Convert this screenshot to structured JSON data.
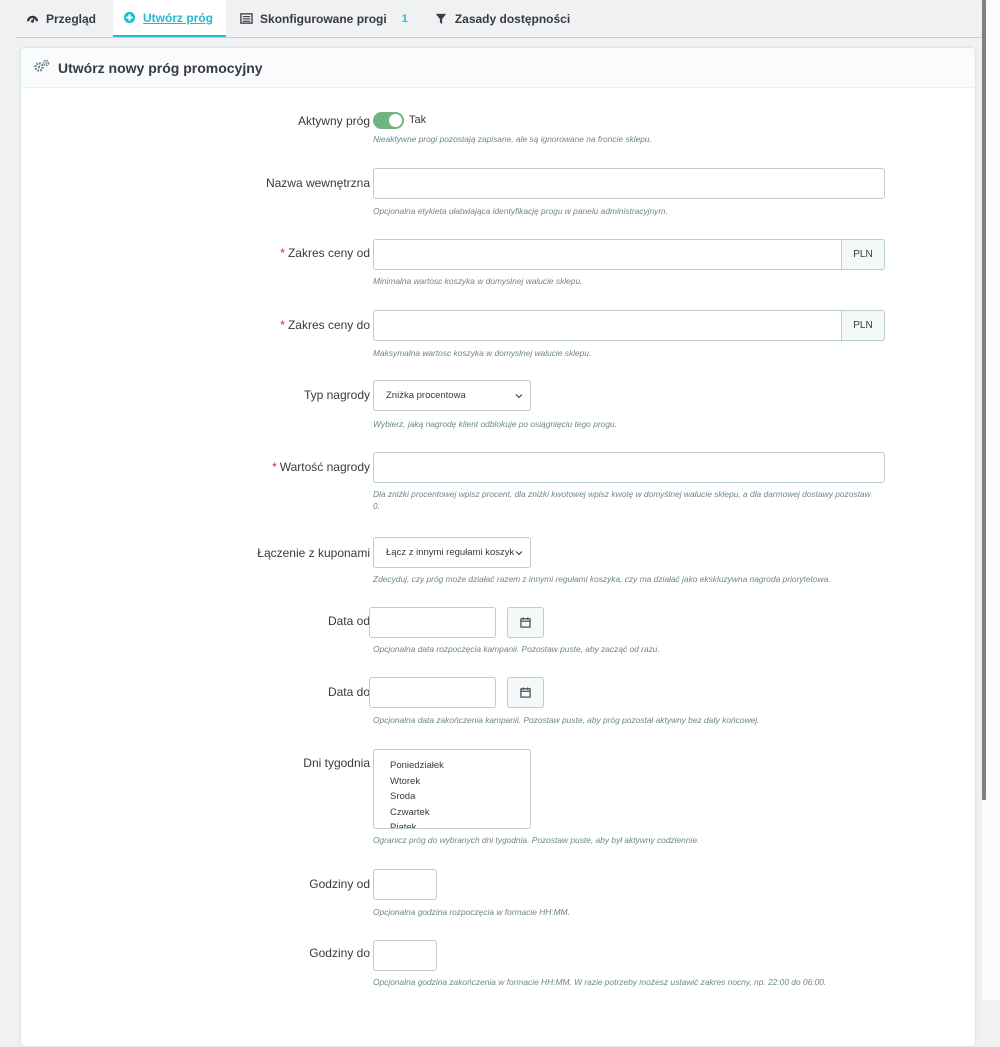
{
  "tabs": [
    {
      "label": "Przegląd",
      "icon": "dashboard-icon"
    },
    {
      "label": "Utwórz próg",
      "icon": "plus-circle-icon",
      "active": true
    },
    {
      "label": "Skonfigurowane progi",
      "icon": "list-icon",
      "badge": "1"
    },
    {
      "label": "Zasady dostępności",
      "icon": "filter-icon"
    }
  ],
  "panel": {
    "title": "Utwórz nowy próg promocyjny",
    "icon": "cogs-icon"
  },
  "form": {
    "active": {
      "label": "Aktywny próg",
      "state": "Tak",
      "on": true,
      "help": "Nieaktywne progi pozostają zapisane, ale są ignorowane na froncie sklepu."
    },
    "name": {
      "label": "Nazwa wewnętrzna",
      "value": "",
      "help": "Opcjonalna etykieta ułatwiająca identyfikację progu w panelu administracyjnym."
    },
    "price_from": {
      "label": "Zakres ceny od",
      "value": "",
      "addon": "PLN",
      "help": "Minimalna wartosc koszyka w domyslnej walucie sklepu."
    },
    "price_to": {
      "label": "Zakres ceny do",
      "value": "",
      "addon": "PLN",
      "help": "Maksymalna wartosc koszyka w domyslnej walucie sklepu."
    },
    "reward_type": {
      "label": "Typ nagrody",
      "value": "Zniżka procentowa",
      "help": "Wybierz, jaką nagrodę klient odblokuje po osiągnięciu tego progu."
    },
    "reward_value": {
      "label": "Wartość nagrody",
      "value": "",
      "help": "Dla zniżki procentowej wpisz procent, dla zniżki kwotowej wpisz kwotę w domyślnej walucie sklepu, a dla darmowej dostawy pozostaw 0."
    },
    "combine": {
      "label": "Łączenie z kuponami",
      "value": "Łącz z innymi regułami koszyka",
      "help": "Zdecyduj, czy próg może działać razem z innymi regułami koszyka, czy ma działać jako ekskluzywna nagroda priorytetowa."
    },
    "date_from": {
      "label": "Data od",
      "value": "",
      "help": "Opcjonalna data rozpoczęcia kampanii. Pozostaw puste, aby zacząć od razu."
    },
    "date_to": {
      "label": "Data do",
      "value": "",
      "help": "Opcjonalna data zakończenia kampanii. Pozostaw puste, aby próg pozostał aktywny bez daty końcowej."
    },
    "days": {
      "label": "Dni tygodnia",
      "options": [
        "Poniedziałek",
        "Wtorek",
        "Sroda",
        "Czwartek",
        "Piątek"
      ],
      "help": "Ogranicz próg do wybranych dni tygodnia. Pozostaw puste, aby był aktywny codziennie."
    },
    "hours_from": {
      "label": "Godziny od",
      "value": "",
      "help": "Opcjonalna godzina rozpoczęcia w formacie HH:MM."
    },
    "hours_to": {
      "label": "Godziny do",
      "value": "",
      "help": "Opcjonalna godzina zakończenia w formacie HH:MM. W razie potrzeby możesz ustawić zakres nocny, np. 22:00 do 06:00."
    }
  },
  "colors": {
    "accent": "#25b9d7",
    "switch_on": "#70b580",
    "required": "#e5292d"
  }
}
